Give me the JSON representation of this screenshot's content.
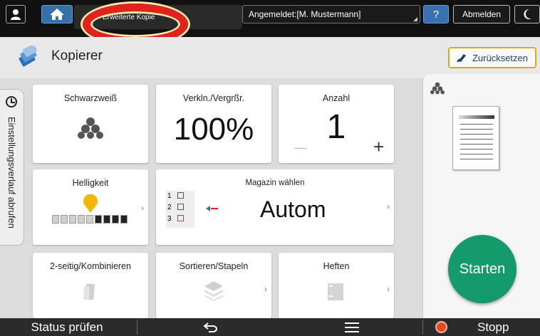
{
  "topbar": {
    "tab_label": "Erweiterte Kopie",
    "login_label": "Angemeldet:[M. Mustermann]",
    "help_label": "?",
    "logout_label": "Abmelden"
  },
  "header": {
    "title": "Kopierer",
    "reset_label": "Zurücksetzen"
  },
  "history_tab": {
    "label": "Einstellungsverlauf abrufen"
  },
  "tiles": {
    "color_mode": {
      "label": "Schwarzweiß"
    },
    "zoom": {
      "label": "Verkln./Vergrßr.",
      "value": "100%"
    },
    "quantity": {
      "label": "Anzahl",
      "value": "1",
      "minus": "—",
      "plus": "+"
    },
    "density": {
      "label": "Helligkeit",
      "level": 5,
      "steps": 9
    },
    "paper_tray": {
      "label": "Magazin wählen",
      "value": "Autom",
      "trays": [
        "1",
        "2",
        "3"
      ]
    },
    "duplex": {
      "label": "2-seitig/Kombinieren"
    },
    "sort": {
      "label": "Sortieren/Stapeln"
    },
    "staple": {
      "label": "Heften"
    }
  },
  "preview": {
    "start_label": "Starten"
  },
  "bottombar": {
    "status_label": "Status prüfen",
    "stop_label": "Stopp"
  },
  "colors": {
    "accent_blue": "#3570a8",
    "start_green": "#159a6b",
    "reset_border": "#e6a717",
    "highlight_ring": "#e1221c",
    "density_marker": "#f2b705"
  }
}
